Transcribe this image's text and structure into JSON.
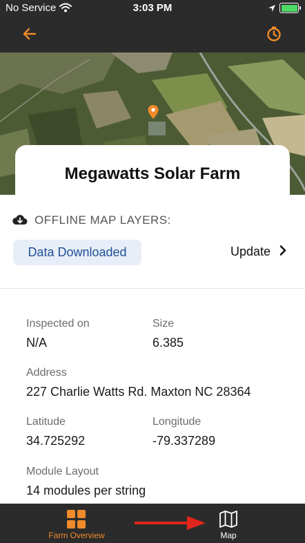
{
  "status_bar": {
    "carrier": "No Service",
    "time": "3:03 PM",
    "wifi_icon": "wifi-icon",
    "location_icon": "location-arrow-icon",
    "battery_icon": "battery-charging-icon"
  },
  "nav": {
    "back_icon": "back-arrow-icon",
    "action_icon": "timer-icon",
    "accent_color": "#f08a2a"
  },
  "map": {
    "pin_icon": "map-pin-icon"
  },
  "farm": {
    "name": "Megawatts Solar Farm"
  },
  "offline": {
    "header": "OFFLINE MAP LAYERS:",
    "cloud_icon": "cloud-download-icon",
    "status_badge": "Data Downloaded",
    "update_label": "Update",
    "badge_bg": "#e8eef7",
    "badge_color": "#1f4f9a"
  },
  "details": {
    "inspected_label": "Inspected on",
    "inspected_value": "N/A",
    "size_label": "Size",
    "size_value": "6.385",
    "address_label": "Address",
    "address_value": "227 Charlie Watts Rd. Maxton NC 28364",
    "latitude_label": "Latitude",
    "latitude_value": "34.725292",
    "longitude_label": "Longitude",
    "longitude_value": "-79.337289",
    "module_label": "Module Layout",
    "module_value": "14 modules per string"
  },
  "tabs": [
    {
      "label": "Farm Overview",
      "icon": "grid-icon",
      "active": true
    },
    {
      "label": "Map",
      "icon": "map-icon",
      "active": false
    }
  ],
  "annotation": {
    "arrow_color": "#e0261c"
  }
}
